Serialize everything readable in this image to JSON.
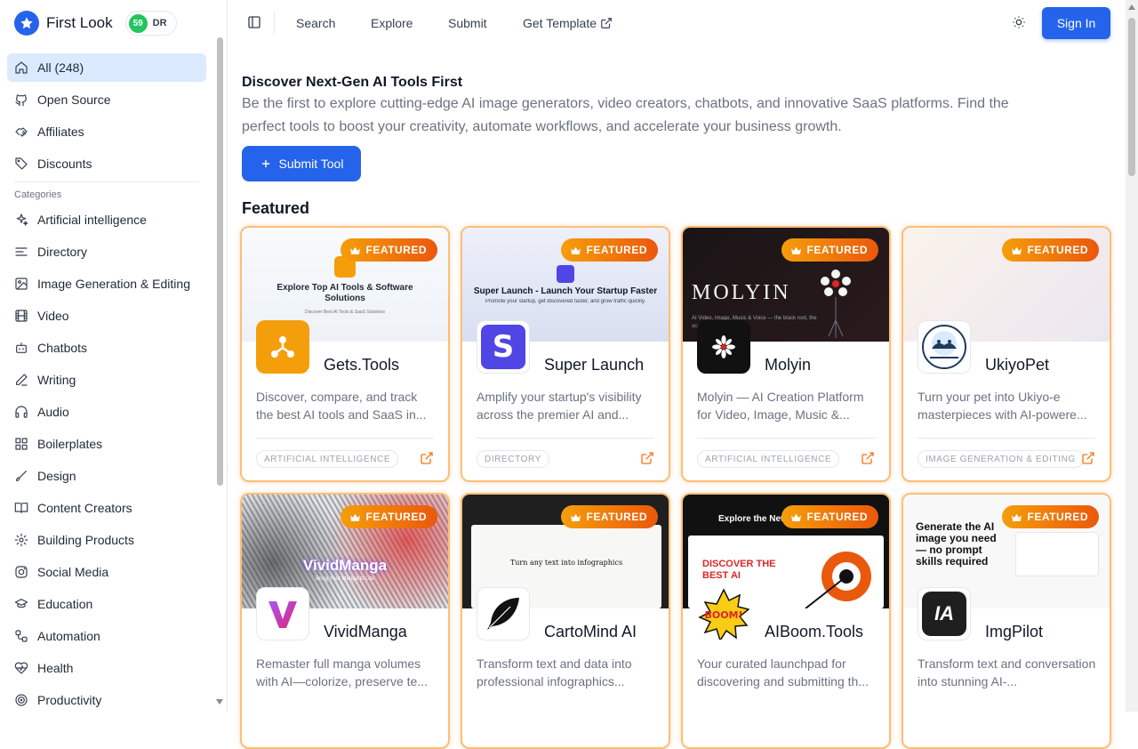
{
  "brand": {
    "name": "First Look",
    "dr_value": "59",
    "dr_label": "DR"
  },
  "sidebar": {
    "top_items": [
      {
        "label": "All (248)",
        "icon": "home-icon",
        "active": true
      },
      {
        "label": "Open Source",
        "icon": "github-icon"
      },
      {
        "label": "Affiliates",
        "icon": "handshake-icon"
      },
      {
        "label": "Discounts",
        "icon": "tag-icon"
      }
    ],
    "categories_heading": "Categories",
    "categories": [
      {
        "label": "Artificial intelligence",
        "icon": "sparkles-icon"
      },
      {
        "label": "Directory",
        "icon": "list-icon"
      },
      {
        "label": "Image Generation & Editing",
        "icon": "image-icon"
      },
      {
        "label": "Video",
        "icon": "film-icon"
      },
      {
        "label": "Chatbots",
        "icon": "bot-icon"
      },
      {
        "label": "Writing",
        "icon": "pen-icon"
      },
      {
        "label": "Audio",
        "icon": "headphones-icon"
      },
      {
        "label": "Boilerplates",
        "icon": "layout-grid-icon"
      },
      {
        "label": "Design",
        "icon": "brush-icon"
      },
      {
        "label": "Content Creators",
        "icon": "book-icon"
      },
      {
        "label": "Building Products",
        "icon": "gear-icon"
      },
      {
        "label": "Social Media",
        "icon": "instagram-icon"
      },
      {
        "label": "Education",
        "icon": "graduation-cap-icon"
      },
      {
        "label": "Automation",
        "icon": "workflow-icon"
      },
      {
        "label": "Health",
        "icon": "heart-pulse-icon"
      },
      {
        "label": "Productivity",
        "icon": "target-icon"
      }
    ]
  },
  "topbar": {
    "links": [
      "Search",
      "Explore",
      "Submit",
      "Get Template"
    ],
    "sign_in": "Sign In"
  },
  "hero": {
    "title": "Discover Next-Gen AI Tools First",
    "description": "Be the first to explore cutting-edge AI image generators, video creators, chatbots, and innovative SaaS platforms. Find the perfect tools to boost your creativity, automate workflows, and accelerate your business growth.",
    "submit_label": "Submit Tool"
  },
  "featured": {
    "heading": "Featured",
    "badge": "FEATURED",
    "cards": [
      {
        "name": "Gets.Tools",
        "desc": "Discover, compare, and track the best AI tools and SaaS in...",
        "tag": "ARTIFICIAL INTELLIGENCE",
        "thumb_title": "Explore Top AI Tools & Software Solutions",
        "thumb_sub": "Discover Best AI Tools & SaaS Solutions"
      },
      {
        "name": "Super Launch",
        "desc": "Amplify your startup's visibility across the premier AI and...",
        "tag": "DIRECTORY",
        "thumb_title": "Super Launch - Launch Your Startup Faster",
        "thumb_sub": "Promote your startup, get discovered faster, and grow traffic quickly."
      },
      {
        "name": "Molyin",
        "desc": "Molyin — AI Creation Platform for Video, Image, Music &...",
        "tag": "ARTIFICIAL INTELLIGENCE",
        "thumb_title": "MOLYIN",
        "thumb_sub": "AI Video, Image, Music & Voice — the black root, the scarlet sorcery."
      },
      {
        "name": "UkiyoPet",
        "desc": "Turn your pet into Ukiyo-e masterpieces with AI-powere...",
        "tag": "IMAGE GENERATION & EDITING",
        "thumb_title": "",
        "thumb_sub": ""
      },
      {
        "name": "VividManga",
        "desc": "Remaster full manga volumes with AI—colorize, preserve te...",
        "tag": "",
        "thumb_title": "VividManga",
        "thumb_sub": "Bring Your Manga to Life"
      },
      {
        "name": "CartoMind AI",
        "desc": "Transform text and data into professional infographics...",
        "tag": "",
        "thumb_title": "Turn any text into infographics",
        "thumb_sub": ""
      },
      {
        "name": "AIBoom.Tools",
        "desc": "Your curated launchpad for discovering and submitting th...",
        "tag": "",
        "thumb_title": "DISCOVER THE BEST AI",
        "thumb_sub": "Explore the New"
      },
      {
        "name": "ImgPilot",
        "desc": "Transform text and conversation into stunning AI-...",
        "tag": "",
        "thumb_title": "Generate the AI image you need — no prompt skills required",
        "thumb_sub": ""
      }
    ]
  },
  "colors": {
    "primary": "#2563eb",
    "featured_badge": "#ea580c",
    "card_border": "#fbbf77"
  }
}
